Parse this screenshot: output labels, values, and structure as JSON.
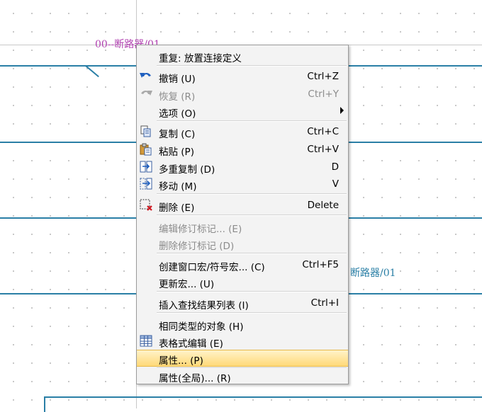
{
  "canvas": {
    "label_top": "00--断路器/01",
    "label_right": "断路器/01",
    "label_top_color": "#b040b0",
    "label_right_color": "#2a7fa6",
    "wire_color": "#2a7fa6"
  },
  "menu": {
    "items": [
      {
        "label": "重复: 放置连接定义",
        "shortcut": "",
        "icon": "",
        "state": "enabled"
      },
      {
        "label": "撤销 (U)",
        "shortcut": "Ctrl+Z",
        "icon": "undo-icon",
        "state": "enabled"
      },
      {
        "label": "恢复 (R)",
        "shortcut": "Ctrl+Y",
        "icon": "redo-icon",
        "state": "disabled"
      },
      {
        "label": "选项 (O)",
        "shortcut": "",
        "icon": "",
        "state": "enabled",
        "submenu": true
      },
      {
        "label": "复制 (C)",
        "shortcut": "Ctrl+C",
        "icon": "copy-icon",
        "state": "enabled"
      },
      {
        "label": "粘贴 (P)",
        "shortcut": "Ctrl+V",
        "icon": "paste-icon",
        "state": "enabled"
      },
      {
        "label": "多重复制 (D)",
        "shortcut": "D",
        "icon": "multi-copy-icon",
        "state": "enabled"
      },
      {
        "label": "移动 (M)",
        "shortcut": "V",
        "icon": "move-icon",
        "state": "enabled"
      },
      {
        "label": "删除 (E)",
        "shortcut": "Delete",
        "icon": "delete-icon",
        "state": "enabled"
      },
      {
        "label": "编辑修订标记... (E)",
        "shortcut": "",
        "icon": "",
        "state": "disabled"
      },
      {
        "label": "删除修订标记 (D)",
        "shortcut": "",
        "icon": "",
        "state": "disabled"
      },
      {
        "label": "创建窗口宏/符号宏... (C)",
        "shortcut": "Ctrl+F5",
        "icon": "",
        "state": "enabled"
      },
      {
        "label": "更新宏... (U)",
        "shortcut": "",
        "icon": "",
        "state": "enabled"
      },
      {
        "label": "插入查找结果列表 (I)",
        "shortcut": "Ctrl+I",
        "icon": "",
        "state": "enabled"
      },
      {
        "label": "相同类型的对象 (H)",
        "shortcut": "",
        "icon": "",
        "state": "enabled"
      },
      {
        "label": "表格式编辑 (E)",
        "shortcut": "",
        "icon": "table-edit-icon",
        "state": "enabled"
      },
      {
        "label": "属性... (P)",
        "shortcut": "",
        "icon": "",
        "state": "selected"
      },
      {
        "label": "属性(全局)... (R)",
        "shortcut": "",
        "icon": "",
        "state": "enabled"
      }
    ]
  }
}
